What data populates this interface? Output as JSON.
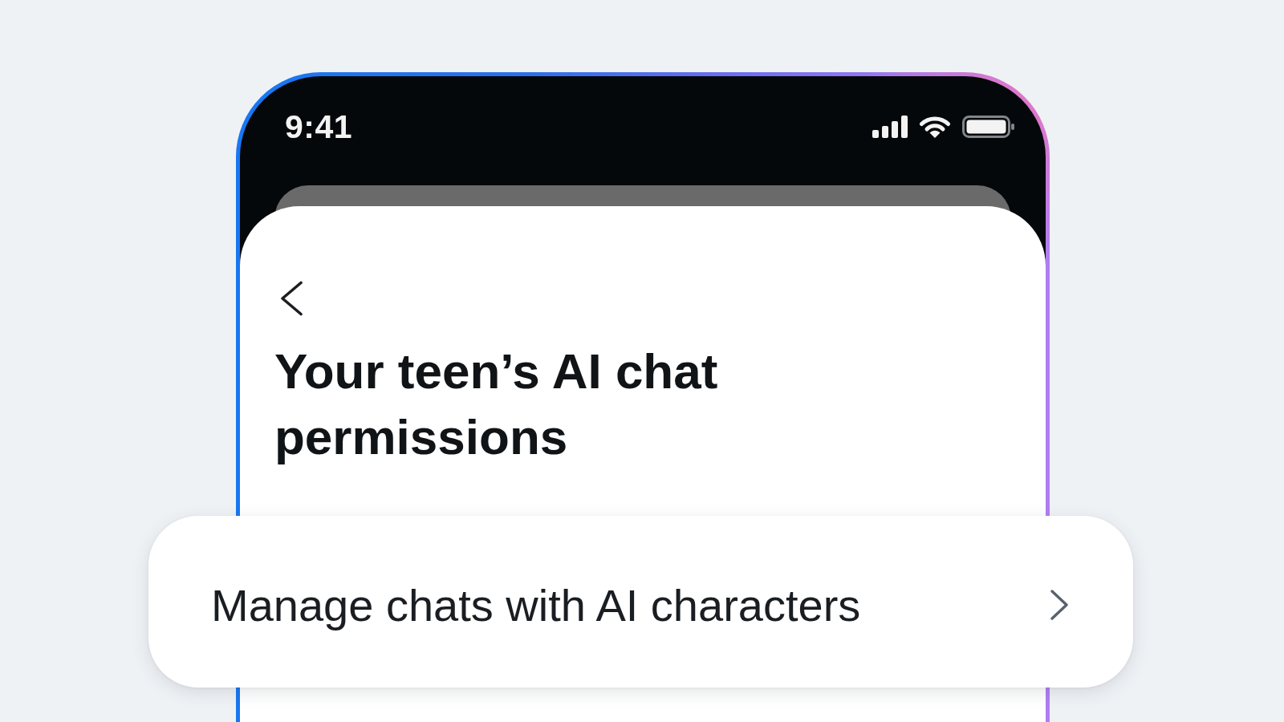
{
  "status_bar": {
    "time": "9:41"
  },
  "screen": {
    "title": "Your teen’s AI chat permissions"
  },
  "menu_items": [
    {
      "label": "Manage chats with AI characters"
    }
  ]
}
